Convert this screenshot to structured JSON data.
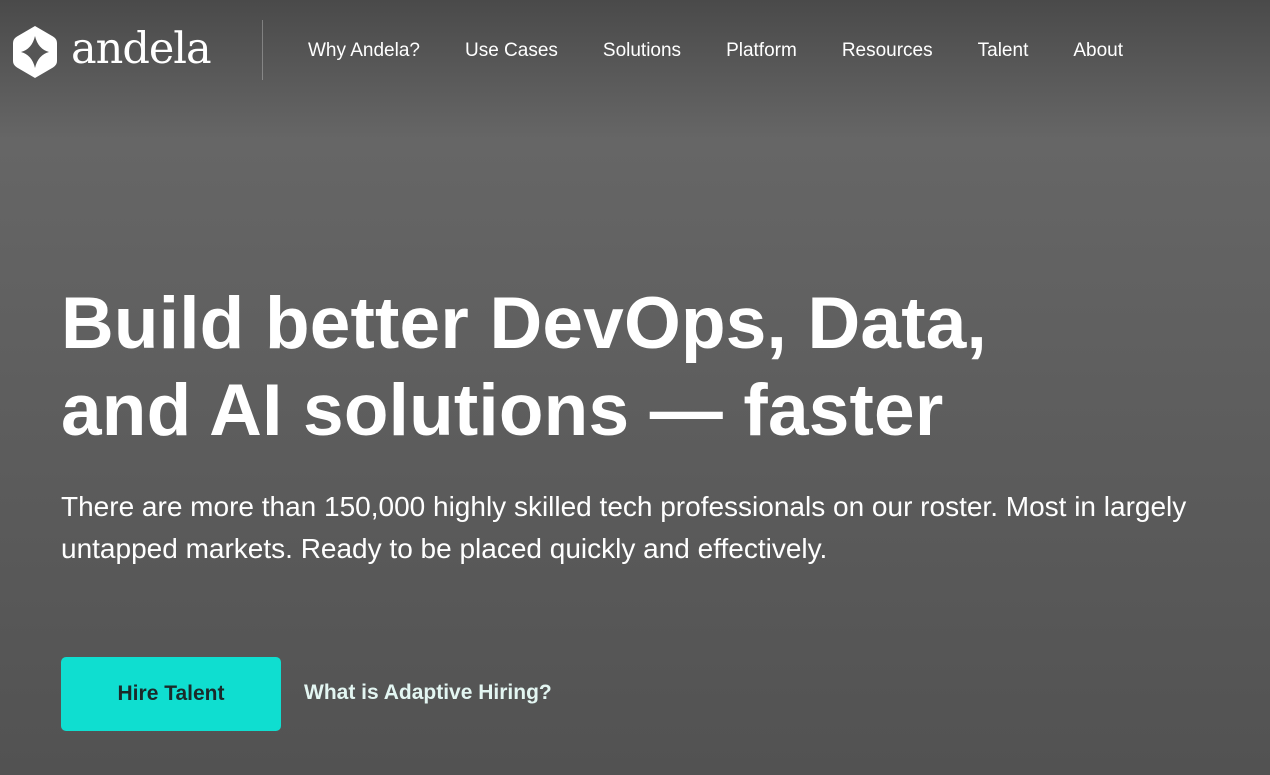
{
  "brand": {
    "name": "andela",
    "icon": "andela-star-logo-icon"
  },
  "nav": {
    "items": [
      {
        "label": "Why Andela?"
      },
      {
        "label": "Use Cases"
      },
      {
        "label": "Solutions"
      },
      {
        "label": "Platform"
      },
      {
        "label": "Resources"
      },
      {
        "label": "Talent"
      },
      {
        "label": "About"
      }
    ]
  },
  "hero": {
    "title_line1": "Build better DevOps, Data,",
    "title_line2": "and AI solutions — faster",
    "subtitle": "There are more than 150,000 highly skilled tech professionals on our roster. Most in largely untapped markets. Ready to be placed quickly and effectively.",
    "primary_cta": "Hire Talent",
    "secondary_cta": "What is Adaptive Hiring?"
  },
  "colors": {
    "accent": "#0fded0",
    "text": "#ffffff",
    "background": "#5f5f5f"
  }
}
